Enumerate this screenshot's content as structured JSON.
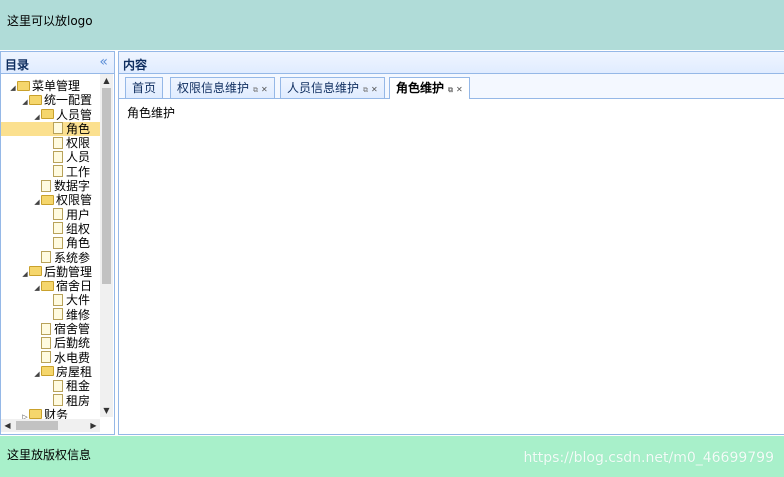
{
  "header": {
    "logo_text": "这里可以放logo"
  },
  "west": {
    "title": "目录",
    "collapse_glyph": "«"
  },
  "tree": [
    {
      "label": "菜单管理",
      "type": "folder",
      "level": 0,
      "expanded": true
    },
    {
      "label": "统一配置",
      "type": "folder",
      "level": 1,
      "expanded": true
    },
    {
      "label": "人员管",
      "type": "folder",
      "level": 2,
      "expanded": true
    },
    {
      "label": "角色",
      "type": "file",
      "level": 3,
      "selected": true
    },
    {
      "label": "权限",
      "type": "file",
      "level": 3
    },
    {
      "label": "人员",
      "type": "file",
      "level": 3
    },
    {
      "label": "工作",
      "type": "file",
      "level": 3
    },
    {
      "label": "数据字",
      "type": "file",
      "level": 2
    },
    {
      "label": "权限管",
      "type": "folder",
      "level": 2,
      "expanded": true
    },
    {
      "label": "用户",
      "type": "file",
      "level": 3
    },
    {
      "label": "组权",
      "type": "file",
      "level": 3
    },
    {
      "label": "角色",
      "type": "file",
      "level": 3
    },
    {
      "label": "系统参",
      "type": "file",
      "level": 2
    },
    {
      "label": "后勤管理",
      "type": "folder",
      "level": 1,
      "expanded": true
    },
    {
      "label": "宿舍日",
      "type": "folder",
      "level": 2,
      "expanded": true
    },
    {
      "label": "大件",
      "type": "file",
      "level": 3
    },
    {
      "label": "维修",
      "type": "file",
      "level": 3
    },
    {
      "label": "宿舍管",
      "type": "file",
      "level": 2
    },
    {
      "label": "后勤统",
      "type": "file",
      "level": 2
    },
    {
      "label": "水电费",
      "type": "file",
      "level": 2
    },
    {
      "label": "房屋租",
      "type": "folder",
      "level": 2,
      "expanded": true
    },
    {
      "label": "租金",
      "type": "file",
      "level": 3
    },
    {
      "label": "租房",
      "type": "file",
      "level": 3
    },
    {
      "label": "财务",
      "type": "folder",
      "level": 1,
      "expanded": false
    }
  ],
  "center": {
    "title": "内容"
  },
  "tabs": [
    {
      "label": "首页",
      "closable": false
    },
    {
      "label": "权限信息维护",
      "closable": true
    },
    {
      "label": "人员信息维护",
      "closable": true
    },
    {
      "label": "角色维护",
      "closable": true,
      "active": true
    }
  ],
  "content_text": "角色维护",
  "footer": {
    "copyright": "这里放版权信息",
    "watermark": "https://blog.csdn.net/m0_46699799"
  },
  "colors": {
    "header_bg": "#b0dcd8",
    "footer_bg": "#a8f0ca",
    "border": "#95b8e7",
    "selected": "#fbe08f"
  }
}
